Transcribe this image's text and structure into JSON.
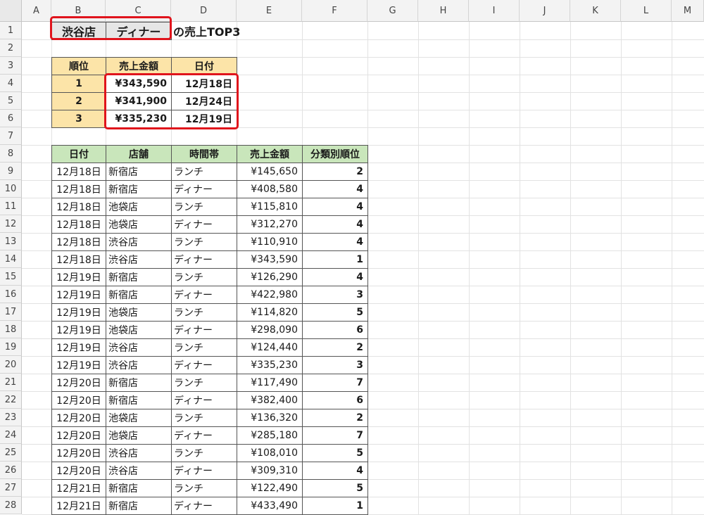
{
  "columns": [
    "A",
    "B",
    "C",
    "D",
    "E",
    "F",
    "G",
    "H",
    "I",
    "J",
    "K",
    "L",
    "M"
  ],
  "rows": [
    "1",
    "2",
    "3",
    "4",
    "5",
    "6",
    "7",
    "8",
    "9",
    "10",
    "11",
    "12",
    "13",
    "14",
    "15",
    "16",
    "17",
    "18",
    "19",
    "20",
    "21",
    "22",
    "23",
    "24",
    "25",
    "26",
    "27",
    "28"
  ],
  "criteria": {
    "store": "渋谷店",
    "timeslot": "ディナー",
    "title_suffix": "の売上TOP3"
  },
  "top3": {
    "headers": [
      "順位",
      "売上金額",
      "日付"
    ],
    "rows": [
      [
        "1",
        "¥343,590",
        "12月18日"
      ],
      [
        "2",
        "¥341,900",
        "12月24日"
      ],
      [
        "3",
        "¥335,230",
        "12月19日"
      ]
    ]
  },
  "sales": {
    "headers": [
      "日付",
      "店舗",
      "時間帯",
      "売上金額",
      "分類別順位"
    ],
    "rows": [
      [
        "12月18日",
        "新宿店",
        "ランチ",
        "¥145,650",
        "2"
      ],
      [
        "12月18日",
        "新宿店",
        "ディナー",
        "¥408,580",
        "4"
      ],
      [
        "12月18日",
        "池袋店",
        "ランチ",
        "¥115,810",
        "4"
      ],
      [
        "12月18日",
        "池袋店",
        "ディナー",
        "¥312,270",
        "4"
      ],
      [
        "12月18日",
        "渋谷店",
        "ランチ",
        "¥110,910",
        "4"
      ],
      [
        "12月18日",
        "渋谷店",
        "ディナー",
        "¥343,590",
        "1"
      ],
      [
        "12月19日",
        "新宿店",
        "ランチ",
        "¥126,290",
        "4"
      ],
      [
        "12月19日",
        "新宿店",
        "ディナー",
        "¥422,980",
        "3"
      ],
      [
        "12月19日",
        "池袋店",
        "ランチ",
        "¥114,820",
        "5"
      ],
      [
        "12月19日",
        "池袋店",
        "ディナー",
        "¥298,090",
        "6"
      ],
      [
        "12月19日",
        "渋谷店",
        "ランチ",
        "¥124,440",
        "2"
      ],
      [
        "12月19日",
        "渋谷店",
        "ディナー",
        "¥335,230",
        "3"
      ],
      [
        "12月20日",
        "新宿店",
        "ランチ",
        "¥117,490",
        "7"
      ],
      [
        "12月20日",
        "新宿店",
        "ディナー",
        "¥382,400",
        "6"
      ],
      [
        "12月20日",
        "池袋店",
        "ランチ",
        "¥136,320",
        "2"
      ],
      [
        "12月20日",
        "池袋店",
        "ディナー",
        "¥285,180",
        "7"
      ],
      [
        "12月20日",
        "渋谷店",
        "ランチ",
        "¥108,010",
        "5"
      ],
      [
        "12月20日",
        "渋谷店",
        "ディナー",
        "¥309,310",
        "4"
      ],
      [
        "12月21日",
        "新宿店",
        "ランチ",
        "¥122,490",
        "5"
      ],
      [
        "12月21日",
        "新宿店",
        "ディナー",
        "¥433,490",
        "1"
      ]
    ]
  },
  "colors": {
    "highlight": "#e0141c",
    "top3_header": "#fce4a8",
    "sales_header": "#c9e6bb",
    "criteria_fill": "#e6e6e6"
  }
}
